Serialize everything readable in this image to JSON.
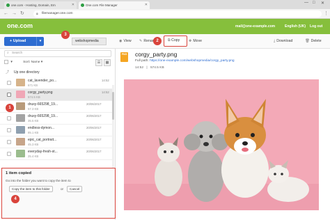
{
  "browser": {
    "tabs": [
      {
        "label": "one.com - Hosting, Domain, Em"
      },
      {
        "label": "One.com File Manager"
      }
    ],
    "url": "filemanager.one.com"
  },
  "header": {
    "logo": "one.com",
    "email": "mail@one-example.com",
    "language": "English (UK)",
    "logout": "Log out"
  },
  "toolbar": {
    "upload_label": "Upload",
    "path_label": "webshopmedia",
    "view_label": "View",
    "rename_label": "Rename",
    "copy_label": "Copy",
    "move_label": "Move",
    "download_label": "Download",
    "delete_label": "Delete"
  },
  "filelist": {
    "search_placeholder": "Search",
    "sort_label": "Sort: Name",
    "updir_label": "Up one directory",
    "files": [
      {
        "name": "cat_lavender_po...",
        "size": "671 KB",
        "date": "14:52",
        "selected": false,
        "thumb": "#d6b38a"
      },
      {
        "name": "corgy_party.png",
        "size": "574.5 KB",
        "date": "14:52",
        "selected": true,
        "thumb": "#f0a7b6"
      },
      {
        "name": "druxy-665298_19...",
        "size": "57.3 KB",
        "date": "20/06/2017",
        "selected": false,
        "thumb": "#b89a7a"
      },
      {
        "name": "druxy-665298_19...",
        "size": "35.5 KB",
        "date": "20/06/2017",
        "selected": false,
        "thumb": "#a3a3a3"
      },
      {
        "name": "endless-dymon...",
        "size": "85.1 KB",
        "date": "20/06/2017",
        "selected": false,
        "thumb": "#8fa0b0"
      },
      {
        "name": "epic_cat_portrait...",
        "size": "45.3 KB",
        "date": "20/06/2017",
        "selected": false,
        "thumb": "#c7a58a"
      },
      {
        "name": "everyday-fresh-st...",
        "size": "25.4 KB",
        "date": "20/06/2017",
        "selected": false,
        "thumb": "#9bbd8e"
      }
    ]
  },
  "copy_panel": {
    "title": "1 item copied",
    "hint": "Go into the folder you want to copy the item to",
    "copy_here_label": "Copy the item to this folder",
    "or_label": "or",
    "cancel_label": "Cancel"
  },
  "preview": {
    "badge": "PNG",
    "filename": "corgy_party.png",
    "full_path_label": "Full path:",
    "full_path": "https://one-example.com/webshopmedia/corgy_party.png",
    "time": "14:52",
    "size": "574.5 KB"
  },
  "callouts": [
    "1",
    "2",
    "3",
    "4"
  ],
  "colors": {
    "brand_green": "#86bf3c",
    "accent_blue": "#2e6dd1",
    "highlight_red": "#d9433b",
    "photo_background": "#f2a6b4"
  }
}
